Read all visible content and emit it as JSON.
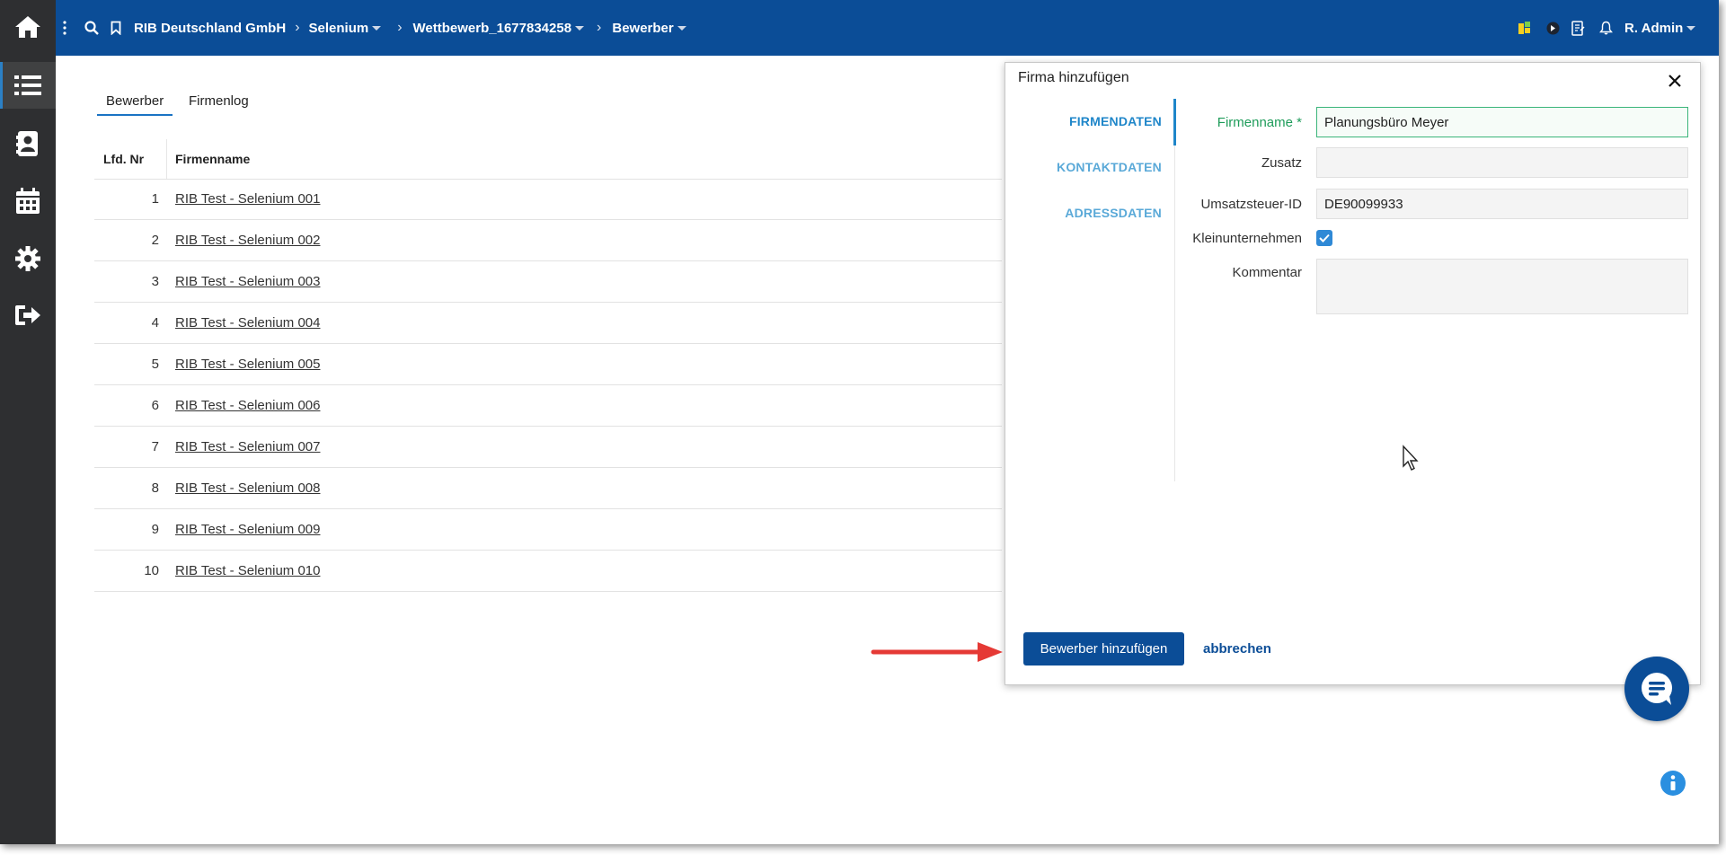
{
  "topbar": {
    "breadcrumbs": [
      "RIB Deutschland GmbH",
      "Selenium",
      "Wettbewerb_1677834258",
      "Bewerber"
    ],
    "user": "R. Admin"
  },
  "sidebar": {
    "items": [
      "home-icon",
      "list-icon",
      "contacts-icon",
      "calendar-icon",
      "gear-icon",
      "logout-icon"
    ]
  },
  "tabs": [
    "Bewerber",
    "Firmenlog"
  ],
  "table": {
    "columns": [
      "Lfd. Nr",
      "Firmenname"
    ],
    "rows": [
      {
        "nr": "1",
        "name": "RIB Test - Selenium 001"
      },
      {
        "nr": "2",
        "name": "RIB Test - Selenium 002"
      },
      {
        "nr": "3",
        "name": "RIB Test - Selenium 003"
      },
      {
        "nr": "4",
        "name": "RIB Test - Selenium 004"
      },
      {
        "nr": "5",
        "name": "RIB Test - Selenium 005"
      },
      {
        "nr": "6",
        "name": "RIB Test - Selenium 006"
      },
      {
        "nr": "7",
        "name": "RIB Test - Selenium 007"
      },
      {
        "nr": "8",
        "name": "RIB Test - Selenium 008"
      },
      {
        "nr": "9",
        "name": "RIB Test - Selenium 009"
      },
      {
        "nr": "10",
        "name": "RIB Test - Selenium 010"
      }
    ]
  },
  "dialog": {
    "title": "Firma hinzufügen",
    "nav": [
      "FIRMENDATEN",
      "KONTAKTDATEN",
      "ADRESSDATEN"
    ],
    "fields": {
      "firmenname_label": "Firmenname *",
      "firmenname_value": "Planungsbüro Meyer",
      "zusatz_label": "Zusatz",
      "zusatz_value": "",
      "ust_label": "Umsatzsteuer-ID",
      "ust_value": "DE90099933",
      "klein_label": "Kleinunternehmen",
      "klein_checked": true,
      "kommentar_label": "Kommentar",
      "kommentar_value": ""
    },
    "primary_button": "Bewerber hinzufügen",
    "cancel_link": "abbrechen"
  },
  "colors": {
    "brand_blue": "#0b4d97",
    "rail": "#2e2f31",
    "accent_link": "#1f86c9",
    "required_green": "#1e9c5a",
    "annotation_arrow": "#e53935"
  }
}
